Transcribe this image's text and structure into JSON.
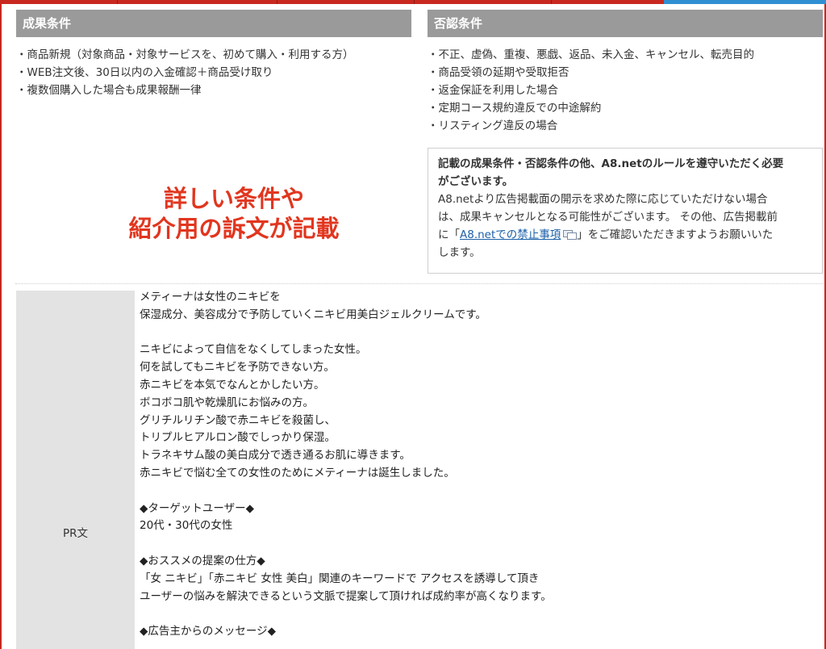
{
  "conditions": {
    "title": "成果条件",
    "items": [
      "商品新規（対象商品・対象サービスを、初めて購入・利用する方）",
      "WEB注文後、30日以内の入金確認＋商品受け取り",
      "複数個購入した場合も成果報酬一律"
    ]
  },
  "rejection": {
    "title": "否認条件",
    "items": [
      "不正、虚偽、重複、悪戯、返品、未入金、キャンセル、転売目的",
      "商品受領の延期や受取拒否",
      "返金保証を利用した場合",
      "定期コース規約違反での中途解約",
      "リスティング違反の場合"
    ]
  },
  "promo": {
    "line1": "詳しい条件や",
    "line2": "紹介用の訴文が記載"
  },
  "notice": {
    "bold_line1": "記載の成果条件・否認条件の他、A8.netのルールを遵守いただく必要",
    "bold_line2": "がございます。",
    "line3": "A8.netより広告掲載面の開示を求めた際に応じていただけない場合",
    "line4": "は、成果キャンセルとなる可能性がございます。 その他、広告掲載前",
    "line5_pre": "に「",
    "link_text": "A8.netでの禁止事項",
    "line5_post": "」をご確認いただきますようお願いいた",
    "line6": "します。"
  },
  "pr": {
    "label": "PR文",
    "lines": [
      "メティーナは女性のニキビを",
      "保湿成分、美容成分で予防していくニキビ用美白ジェルクリームです。",
      "",
      "ニキビによって自信をなくしてしまった女性。",
      "何を試してもニキビを予防できない方。",
      "赤ニキビを本気でなんとかしたい方。",
      "ボコボコ肌や乾燥肌にお悩みの方。",
      "グリチルリチン酸で赤ニキビを殺菌し、",
      "トリプルヒアルロン酸でしっかり保湿。",
      "トラネキサム酸の美白成分で透き通るお肌に導きます。",
      "赤ニキビで悩む全ての女性のためにメティーナは誕生しました。",
      "",
      "◆ターゲットユーザー◆",
      "20代・30代の女性",
      "",
      "◆おススメの提案の仕方◆",
      "「女 ニキビ」「赤ニキビ 女性 美白」関連のキーワードで アクセスを誘導して頂き",
      "ユーザーの悩みを解決できるという文脈で提案して頂ければ成約率が高くなります。",
      "",
      "◆広告主からのメッセージ◆"
    ]
  },
  "colors": {
    "header_bg": "#9a9a9a",
    "promo_text": "#e1361f",
    "top_bar_red": "#c8281f",
    "top_bar_blue": "#2f8fd2",
    "link": "#1a5fa8"
  },
  "icons": {
    "external_link": "external-window-icon"
  }
}
